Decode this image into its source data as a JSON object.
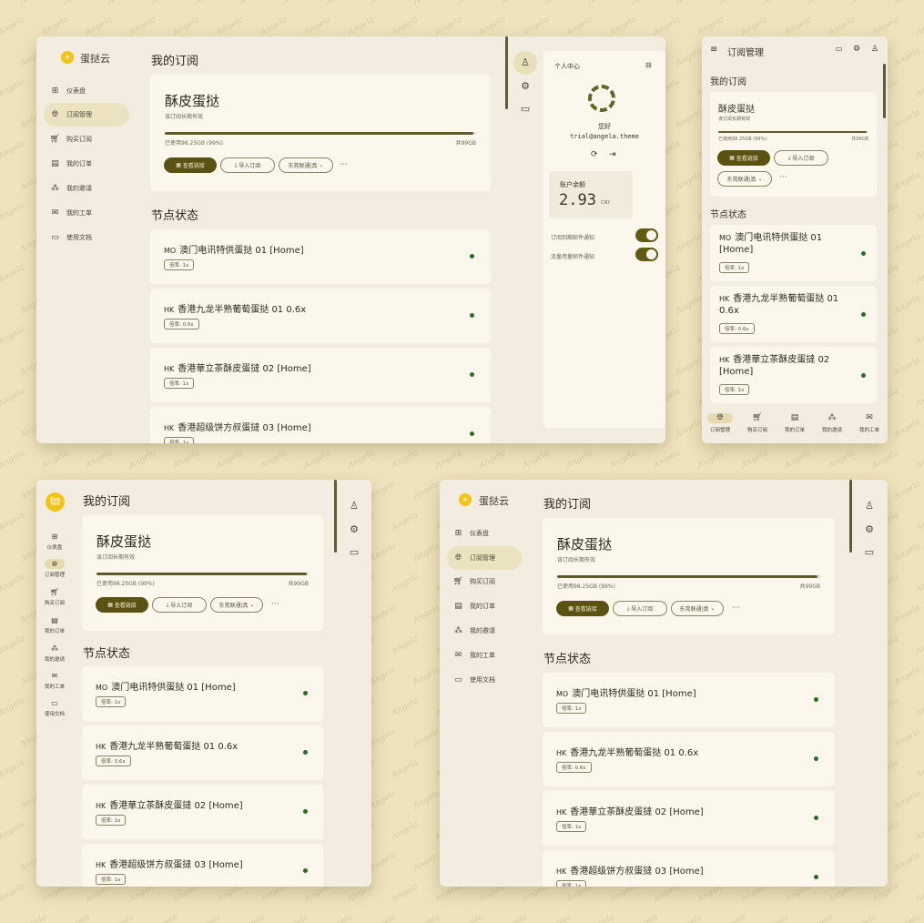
{
  "brand": {
    "name": "蛋挞云",
    "logo_text": "Egg Tart"
  },
  "nav": [
    {
      "label": "仪表盘",
      "icon": "dashboard-icon"
    },
    {
      "label": "订阅管理",
      "icon": "globe-icon"
    },
    {
      "label": "购买订阅",
      "icon": "cart-icon"
    },
    {
      "label": "我的订单",
      "icon": "order-icon"
    },
    {
      "label": "我的邀请",
      "icon": "invite-icon"
    },
    {
      "label": "我的工单",
      "icon": "ticket-icon"
    },
    {
      "label": "使用文档",
      "icon": "docs-icon"
    }
  ],
  "page_title": "我的订阅",
  "subscription": {
    "name": "酥皮蛋挞",
    "validity": "该订阅长期有效",
    "used_text": "已使用98.25GB (99%)",
    "total_text": "共99GB",
    "usage_fraction": 0.99,
    "view_link_label": "查看链接",
    "import_label": "导入订阅",
    "select_value": "东莞联通|真",
    "more": "···"
  },
  "nodes_title": "节点状态",
  "nodes": [
    {
      "region": "MO",
      "name": "澳门电讯特供蛋挞 01 [Home]",
      "rate": "倍率: 1x"
    },
    {
      "region": "HK",
      "name": "香港九龙半熟葡萄蛋挞 01 0.6x",
      "rate": "倍率: 0.6x"
    },
    {
      "region": "HK",
      "name": "香港華立茶酥皮蛋撻 02 [Home]",
      "rate": "倍率: 1x"
    },
    {
      "region": "HK",
      "name": "香港超级饼方叔蛋撻 03 [Home]",
      "rate": "倍率: 1x"
    }
  ],
  "mobile_nodes": [
    {
      "region": "MO",
      "line1": "澳门电讯特供蛋挞 01",
      "line2": "[Home]",
      "rate": "倍率: 1x"
    },
    {
      "region": "HK",
      "line1": "香港九龙半熟葡萄蛋挞 01",
      "line2": "0.6x",
      "rate": "倍率: 0.6x"
    },
    {
      "region": "HK",
      "line1": "香港華立茶酥皮蛋撻 02",
      "line2": "[Home]",
      "rate": "倍率: 1x"
    }
  ],
  "profile": {
    "title": "个人中心",
    "greeting": "您好",
    "email": "trial@angela.theme",
    "balance_label": "账户余额",
    "balance_value": "2.93",
    "balance_unit": "CNY",
    "toggle1": "订阅到期邮件通知",
    "toggle2": "流量用量邮件通知",
    "toggle1_on": true,
    "toggle2_on": true
  },
  "mobile": {
    "title": "订阅管理"
  },
  "bottom_nav": [
    "订阅管理",
    "购买订阅",
    "我的订单",
    "我的邀请",
    "我的工单"
  ],
  "colors": {
    "primary": "#5a5213",
    "accent": "#f2c417",
    "online": "#2e6b2a",
    "bg": "#efe3bd"
  }
}
